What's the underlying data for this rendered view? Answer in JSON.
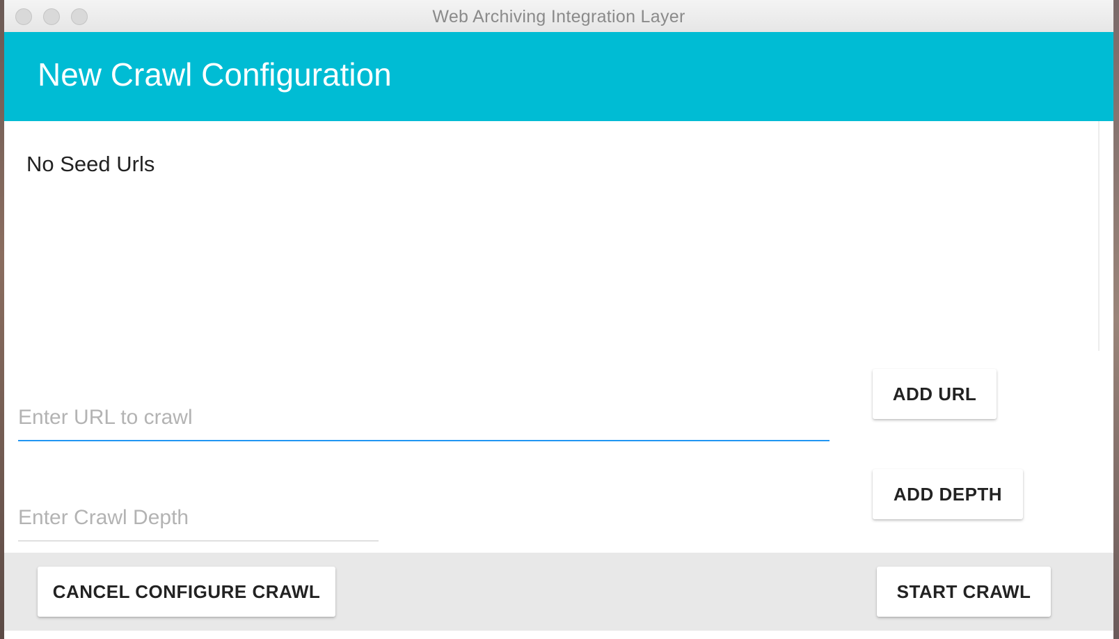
{
  "window": {
    "title": "Web Archiving Integration Layer"
  },
  "appbar": {
    "title": "New Crawl Configuration",
    "color": "#00bcd4"
  },
  "seed_list": {
    "empty_text": "No Seed Urls"
  },
  "url_input": {
    "value": "",
    "placeholder": "Enter URL to crawl",
    "focused_color": "#2196f3"
  },
  "depth_input": {
    "value": "",
    "placeholder": "Enter Crawl Depth"
  },
  "buttons": {
    "add_url": "ADD URL",
    "add_depth": "ADD DEPTH",
    "cancel": "CANCEL CONFIGURE CRAWL",
    "start": "START CRAWL"
  }
}
